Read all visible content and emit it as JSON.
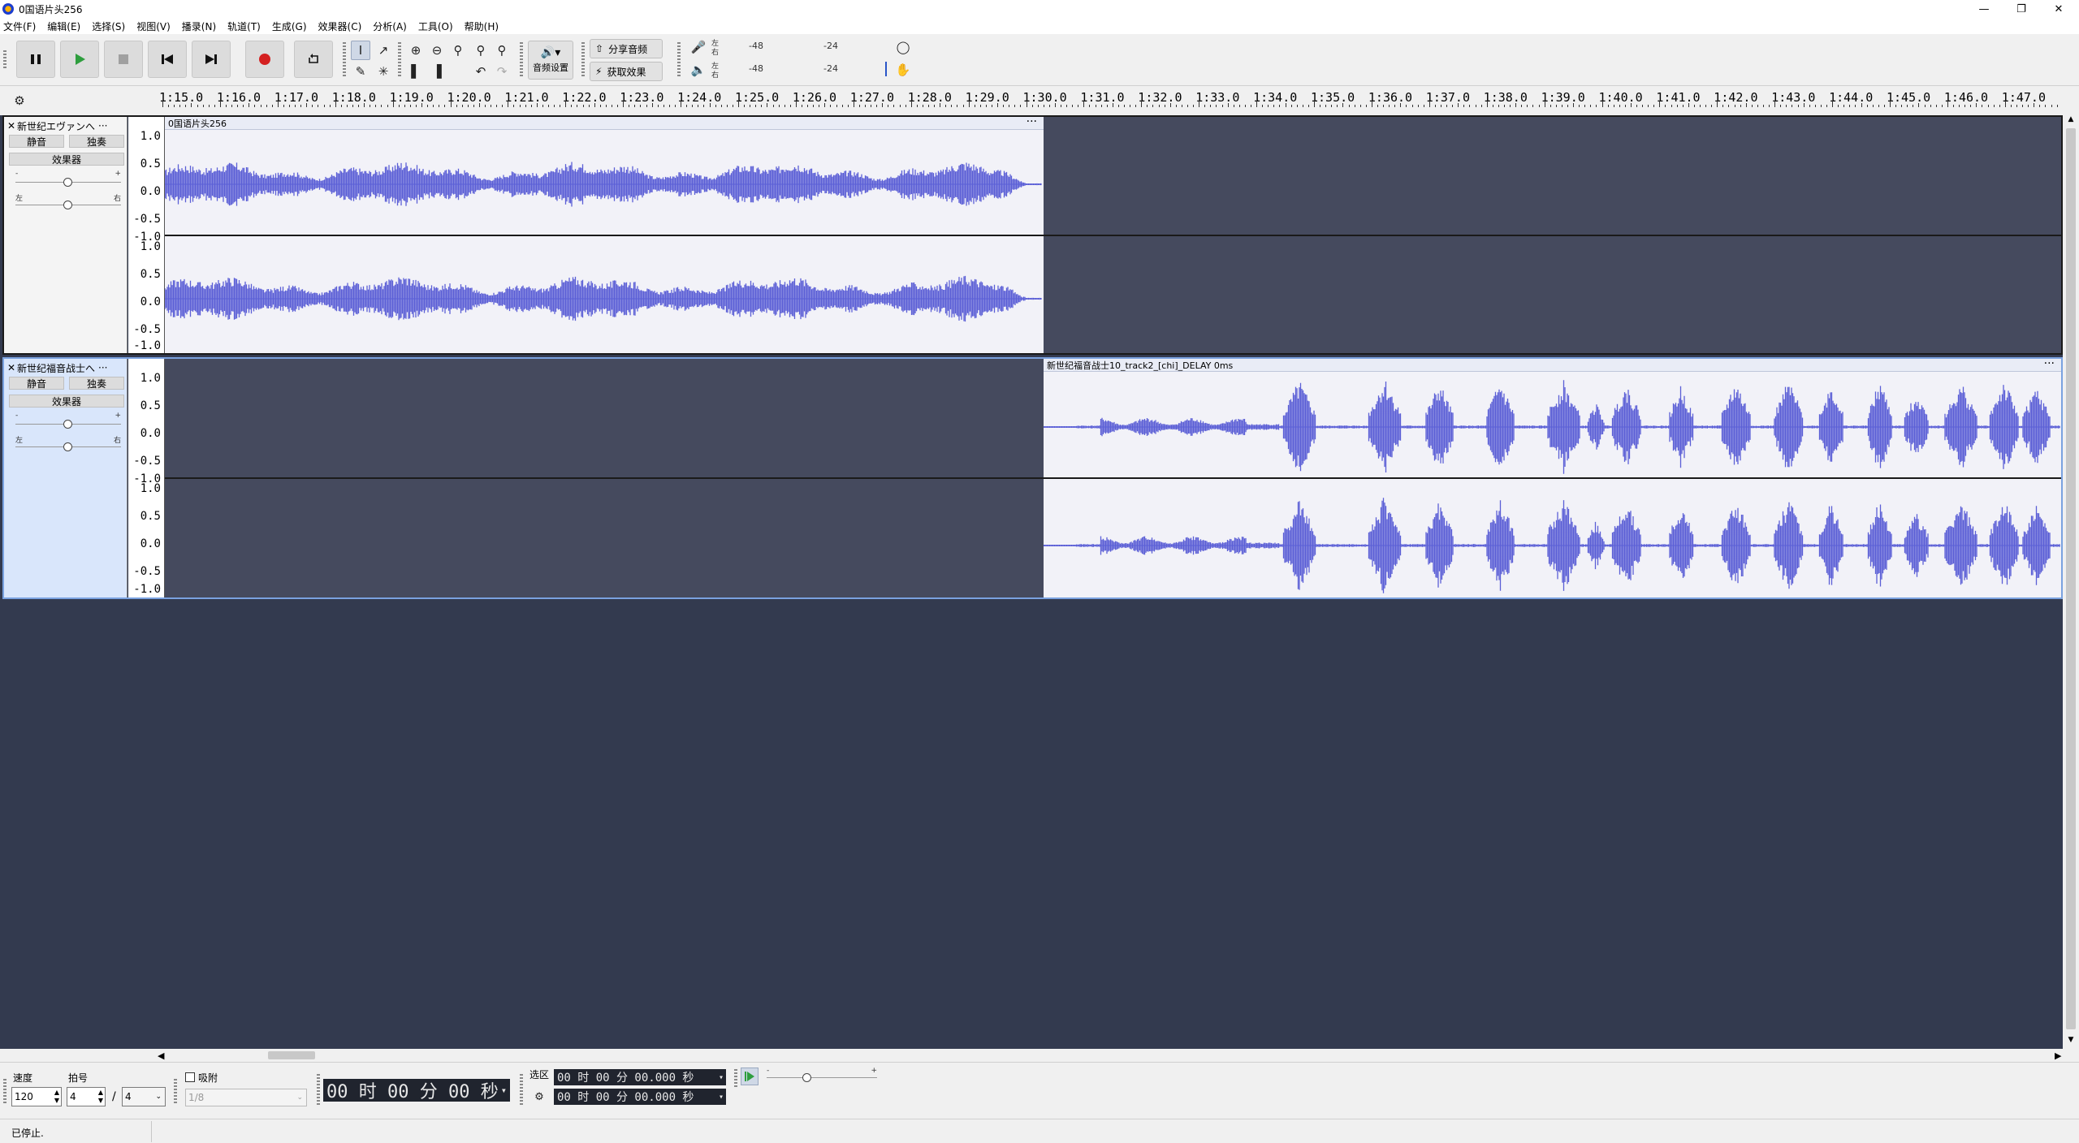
{
  "window": {
    "title": "0国语片头256"
  },
  "menu": [
    "文件(F)",
    "编辑(E)",
    "选择(S)",
    "视图(V)",
    "播录(N)",
    "轨道(T)",
    "生成(G)",
    "效果器(C)",
    "分析(A)",
    "工具(O)",
    "帮助(H)"
  ],
  "toolbar": {
    "audio_settings_label": "音频设置",
    "share_audio_label": "分享音频",
    "get_effects_label": "获取效果",
    "meter_ticks": [
      "-48",
      "-24"
    ],
    "meter_lr": [
      "左",
      "右"
    ]
  },
  "ruler": {
    "labels": [
      "1:15.0",
      "1:16.0",
      "1:17.0",
      "1:18.0",
      "1:19.0",
      "1:20.0",
      "1:21.0",
      "1:22.0",
      "1:23.0",
      "1:24.0",
      "1:25.0",
      "1:26.0",
      "1:27.0",
      "1:28.0",
      "1:29.0",
      "1:30.0",
      "1:31.0",
      "1:32.0",
      "1:33.0",
      "1:34.0",
      "1:35.0",
      "1:36.0",
      "1:37.0",
      "1:38.0",
      "1:39.0",
      "1:40.0",
      "1:41.0",
      "1:42.0",
      "1:43.0",
      "1:44.0",
      "1:45.0",
      "1:46.0",
      "1:47.0"
    ]
  },
  "tracks": [
    {
      "name": "新世纪エヴァンへ",
      "mute": "静音",
      "solo": "独奏",
      "effects": "效果器",
      "gain_minus": "-",
      "gain_plus": "+",
      "pan_left": "左",
      "pan_right": "右",
      "clip_name": "0国语片头256",
      "clip_menu": "···",
      "scale": [
        "1.0",
        "0.5",
        "0.0",
        "-0.5",
        "-1.0"
      ]
    },
    {
      "name": "新世纪福音战士へ",
      "mute": "静音",
      "solo": "独奏",
      "effects": "效果器",
      "gain_minus": "-",
      "gain_plus": "+",
      "pan_left": "左",
      "pan_right": "右",
      "clip_name": "新世纪福音战士10_track2_[chi]_DELAY 0ms",
      "clip_menu": "···",
      "scale": [
        "1.0",
        "0.5",
        "0.0",
        "-0.5",
        "-1.0"
      ]
    }
  ],
  "bottom": {
    "tempo_label": "速度",
    "tempo_value": "120",
    "timesig_label": "拍号",
    "timesig_num": "4",
    "timesig_slash": "/",
    "timesig_den": "4",
    "snap_label": "吸附",
    "snap_value": "1/8",
    "time_display": "00 时 00 分 00 秒",
    "selection_label": "选区",
    "sel_start": "00 时 00 分 00.000 秒",
    "sel_end": "00 时 00 分 00.000 秒",
    "speed_minus": "-",
    "speed_plus": "+"
  },
  "status": {
    "text": "已停止."
  }
}
